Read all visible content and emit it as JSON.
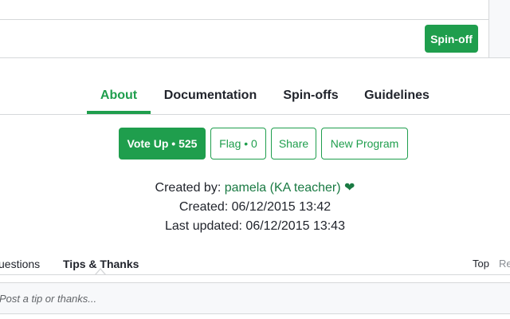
{
  "toolbar": {
    "spinoff_label": "Spin-off"
  },
  "tabs": [
    {
      "label": "About",
      "active": true
    },
    {
      "label": "Documentation",
      "active": false
    },
    {
      "label": "Spin-offs",
      "active": false
    },
    {
      "label": "Guidelines",
      "active": false
    }
  ],
  "actions": {
    "vote_up": "Vote Up • 525",
    "flag": "Flag • 0",
    "share": "Share",
    "new_program": "New Program"
  },
  "meta": {
    "created_by_label": "Created by:",
    "author": "pamela (KA teacher)",
    "heart_icon": "❤",
    "created_line": "Created: 06/12/2015 13:42",
    "updated_line": "Last updated: 06/12/2015 13:43"
  },
  "discussion": {
    "questions_label": "uestions",
    "tips_label": "Tips & Thanks",
    "sort_top": "Top",
    "sort_recent": "Re",
    "tip_placeholder": "Post a tip or thanks..."
  },
  "colors": {
    "accent": "#1f9e4d",
    "author": "#1a7a43",
    "border": "#d6d8da"
  }
}
